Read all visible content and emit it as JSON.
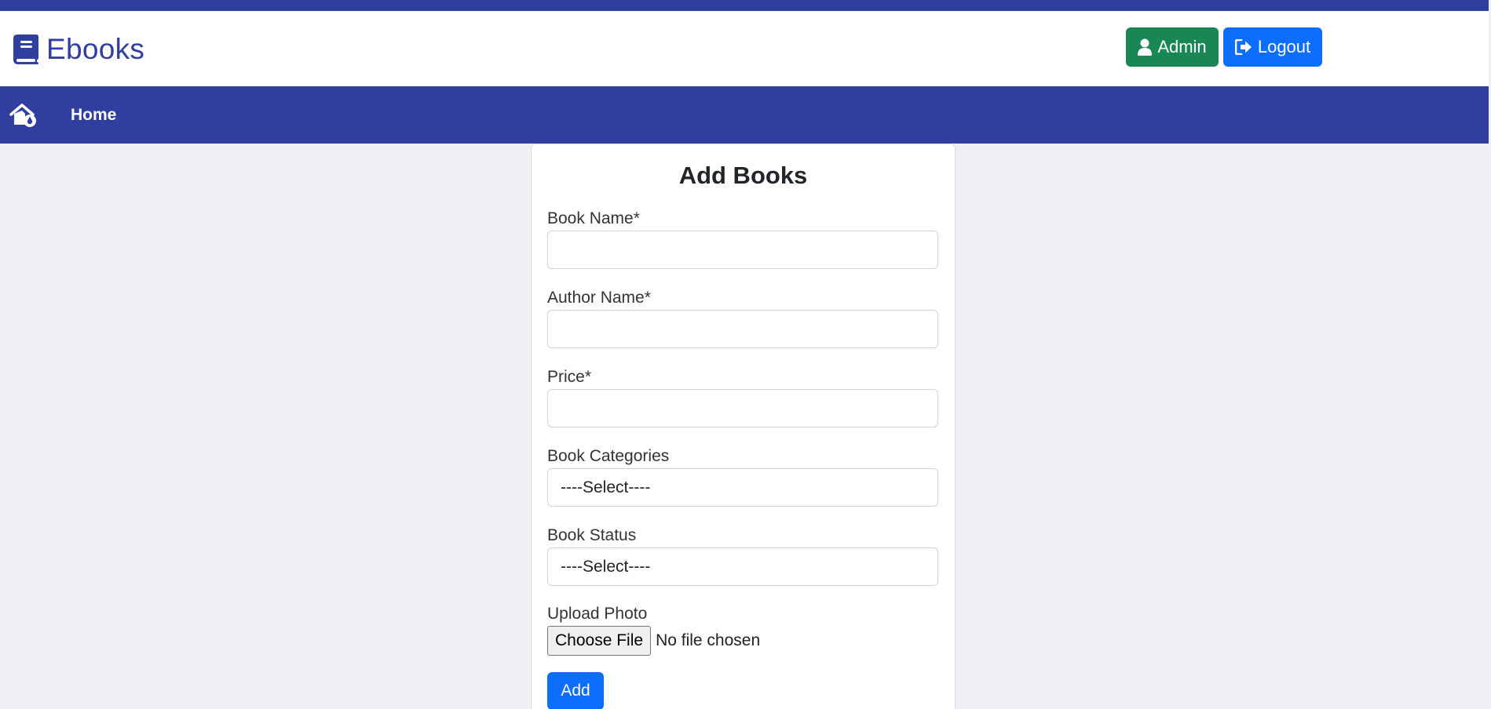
{
  "header": {
    "brand": "Ebooks",
    "admin_label": "Admin",
    "logout_label": "Logout"
  },
  "nav": {
    "home_label": "Home"
  },
  "form": {
    "title": "Add Books",
    "book_name_label": "Book Name*",
    "book_name_value": "",
    "author_name_label": "Author Name*",
    "author_name_value": "",
    "price_label": "Price*",
    "price_value": "",
    "categories_label": "Book Categories",
    "categories_selected": "----Select----",
    "status_label": "Book Status",
    "status_selected": "----Select----",
    "upload_label": "Upload Photo",
    "choose_file_label": "Choose File",
    "file_status": "No file chosen",
    "add_label": "Add"
  },
  "colors": {
    "primary_indigo": "#303f9f",
    "admin_green": "#198754",
    "logout_blue": "#0d6efd",
    "background": "#eff0f3"
  },
  "icons": {
    "brand": "book-icon",
    "admin": "user-icon",
    "logout": "sign-out-icon",
    "nav_home": "home-icon"
  }
}
